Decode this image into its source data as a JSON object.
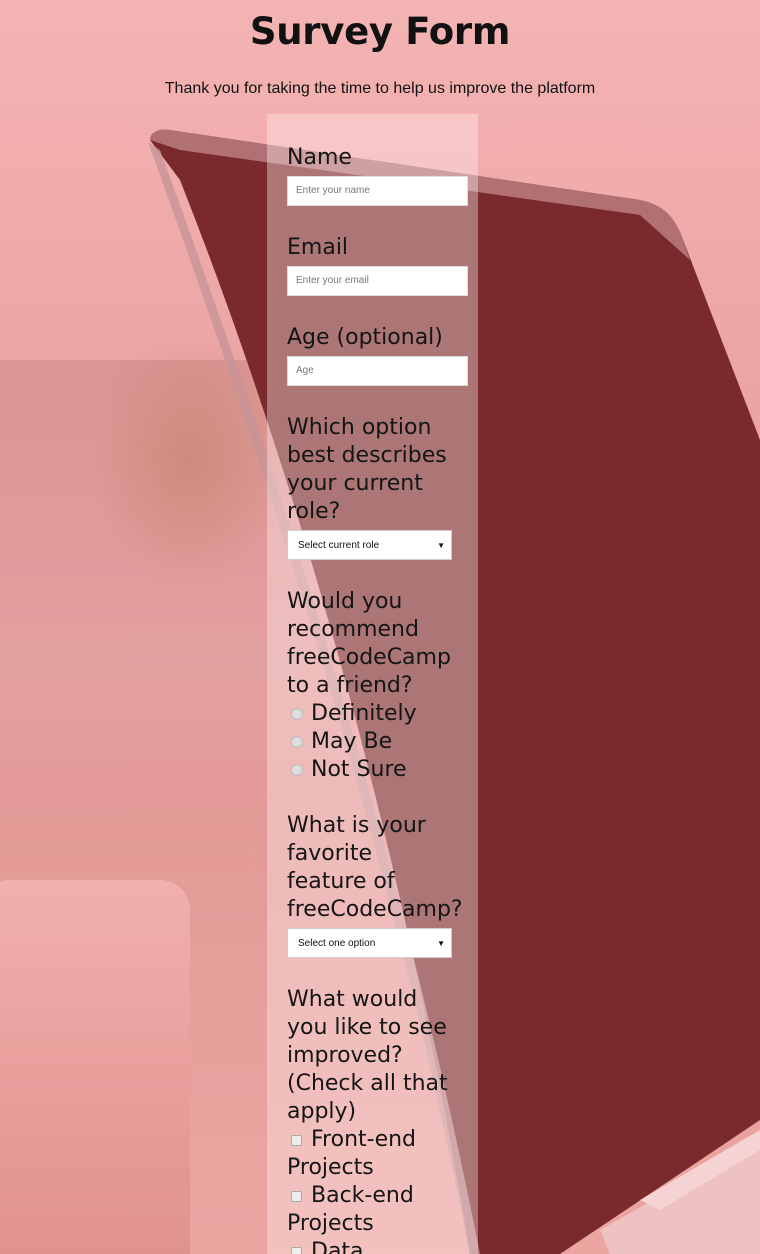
{
  "header": {
    "title": "Survey Form",
    "description": "Thank you for taking the time to help us improve the platform"
  },
  "form": {
    "name": {
      "label": "Name",
      "placeholder": "Enter your name"
    },
    "email": {
      "label": "Email",
      "placeholder": "Enter your email"
    },
    "age": {
      "label": "Age (optional)",
      "placeholder": "Age"
    },
    "role": {
      "label": "Which option best describes your current role?",
      "selected": "Select current role"
    },
    "recommend": {
      "label": "Would you recommend freeCodeCamp to a friend?",
      "options": [
        "Definitely",
        "May Be",
        "Not Sure"
      ]
    },
    "feature": {
      "label": "What is your favorite feature of freeCodeCamp?",
      "selected": "Select one option"
    },
    "improve": {
      "label": "What would you like to see improved? (Check all that apply)",
      "options": [
        "Front-end Projects",
        "Back-end Projects",
        "Data"
      ]
    }
  },
  "colors": {
    "background_tint": "#f2a8a8",
    "form_panel": "#fff0f0"
  }
}
